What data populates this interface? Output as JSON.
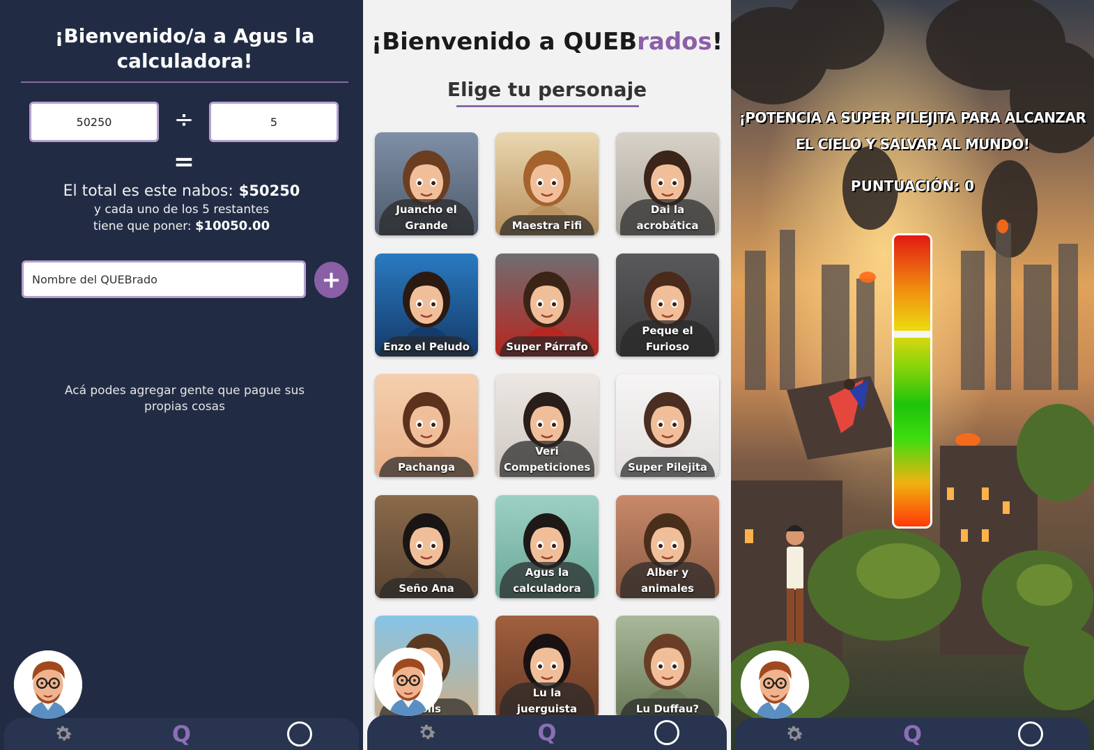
{
  "calculator": {
    "title": "¡Bienvenido/a a Agus la calculadora!",
    "amount_value": "50250",
    "divide_symbol": "÷",
    "people_value": "5",
    "equals_symbol": "=",
    "total_label": "El total es este nabos:",
    "total_value": "$50250",
    "each_label_line1": "y cada uno de los 5 restantes",
    "each_label_line2": "tiene que poner:",
    "each_value": "$10050.00",
    "name_placeholder": "Nombre del QUEBrado",
    "add_symbol": "+",
    "hint": "Acá podes agregar gente que pague sus propias cosas"
  },
  "selector": {
    "title_prefix": "¡Bienvenido a QUEB",
    "title_accent": "rados",
    "title_suffix": "!",
    "subtitle": "Elige tu personaje",
    "characters": [
      {
        "label": "Juancho el Grande"
      },
      {
        "label": "Maestra Fifi"
      },
      {
        "label": "Dai la acrobática"
      },
      {
        "label": "Enzo el Peludo"
      },
      {
        "label": "Super Párrafo"
      },
      {
        "label": "Peque el Furioso"
      },
      {
        "label": "Pachanga"
      },
      {
        "label": "Veri Competiciones"
      },
      {
        "label": "Super Pilejita"
      },
      {
        "label": "Seño Ana"
      },
      {
        "label": "Agus la calculadora"
      },
      {
        "label": "Alber y animales"
      },
      {
        "label": "Dolls"
      },
      {
        "label": "Lu la juerguista"
      },
      {
        "label": "Lu Duffau?"
      }
    ]
  },
  "game": {
    "headline": "¡POTENCIA A SUPER PILEJITA PARA ALCANZAR EL CIELO Y SALVAR AL MUNDO!",
    "score_label": "PUNTUACIÓN:",
    "score_value": "0",
    "power_level": 0.66
  },
  "nav": {
    "items": [
      {
        "icon": "gear-icon"
      },
      {
        "icon": "q-logo-icon",
        "label": "Q"
      },
      {
        "icon": "circle-icon"
      }
    ]
  },
  "colors": {
    "dark_bg": "#212c44",
    "accent_purple": "#8b5fa8",
    "light_bg": "#f2f2f3"
  }
}
